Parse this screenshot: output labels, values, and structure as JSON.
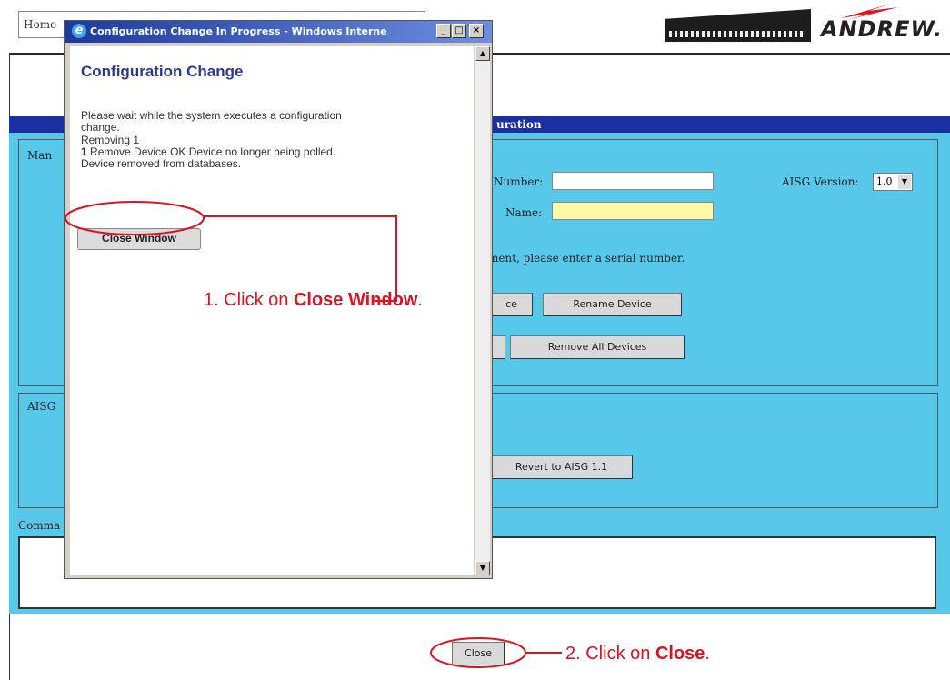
{
  "header": {
    "home_tab": "Home",
    "logo_text": "ANDREW."
  },
  "main": {
    "title_fragment": "uration",
    "manage_legend": "Man",
    "aisg_legend": "AISG",
    "command_label": "Comma",
    "serial_label": "Number:",
    "name_label": "Name:",
    "aisg_version_label": "AISG Version:",
    "aisg_version_value": "1.0",
    "hint_text": "ment, please enter a serial number.",
    "rename_button": "Rename Device",
    "partial_button": "ce",
    "remove_all_button": "Remove All Devices",
    "revert_button": "Revert to AISG 1.1",
    "close_button": "Close"
  },
  "dialog": {
    "window_title": "Configuration Change In Progress - Windows Interne",
    "heading": "Configuration Change",
    "message_line1": "Please wait while the system executes a configuration",
    "message_line2": "change.",
    "removing": "Removing 1",
    "result_num": "1",
    "result_line1": "Remove Device OK Device no longer being polled.",
    "result_line2": "Device removed from databases.",
    "close_window_button": "Close Window",
    "scroll_up": "▲",
    "scroll_down": "▼",
    "minimize": "_",
    "maximize": "□",
    "close": "×",
    "icon_letter": "e"
  },
  "annotations": {
    "step1_prefix": "1. Click on ",
    "step1_bold": "Close Window",
    "step1_suffix": ".",
    "step2_prefix": "2. Click on ",
    "step2_bold": "Close",
    "step2_suffix": "."
  },
  "colors": {
    "panel_bg": "#57c8ea",
    "title_bar": "#1a2fa0",
    "annotation": "#e0121f",
    "dialog_heading": "#2c3991",
    "name_field": "#fff8a6"
  }
}
